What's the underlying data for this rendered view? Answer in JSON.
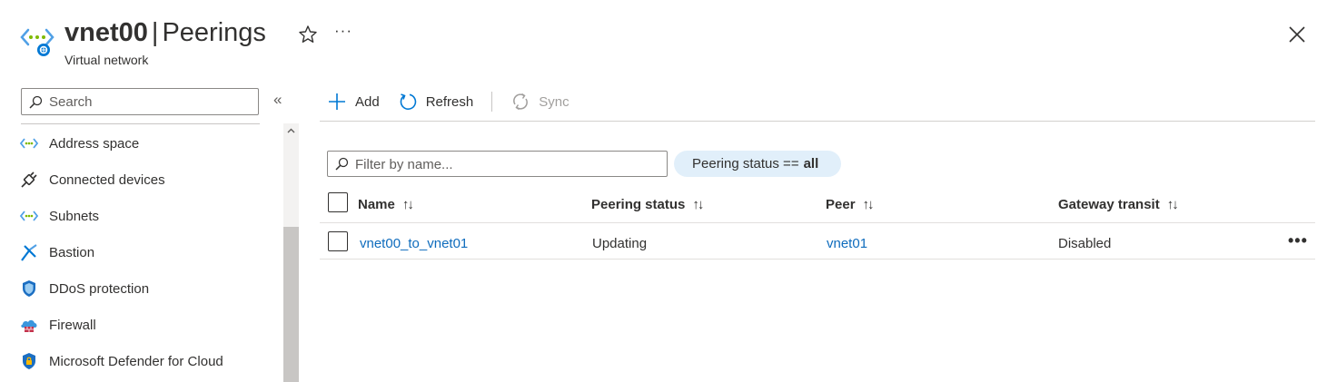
{
  "header": {
    "resource_name": "vnet00",
    "separator": "|",
    "page_name": "Peerings",
    "subtitle": "Virtual network",
    "more_label": "···",
    "icon": "virtual-network-icon"
  },
  "sidebar": {
    "search_placeholder": "Search",
    "collapse_label": "«",
    "items": [
      {
        "label": "Address space",
        "icon": "address-space-icon"
      },
      {
        "label": "Connected devices",
        "icon": "plug-icon"
      },
      {
        "label": "Subnets",
        "icon": "subnet-icon"
      },
      {
        "label": "Bastion",
        "icon": "bastion-icon"
      },
      {
        "label": "DDoS protection",
        "icon": "shield-icon"
      },
      {
        "label": "Firewall",
        "icon": "firewall-icon"
      },
      {
        "label": "Microsoft Defender for Cloud",
        "icon": "defender-icon"
      }
    ]
  },
  "toolbar": {
    "add_label": "Add",
    "refresh_label": "Refresh",
    "sync_label": "Sync"
  },
  "filter": {
    "placeholder": "Filter by name...",
    "pill_key": "Peering status ==",
    "pill_value": "all"
  },
  "table": {
    "columns": [
      {
        "label": "Name",
        "sort": "↑↓"
      },
      {
        "label": "Peering status",
        "sort": "↑↓"
      },
      {
        "label": "Peer",
        "sort": "↑↓"
      },
      {
        "label": "Gateway transit",
        "sort": "↑↓"
      }
    ],
    "rows": [
      {
        "name": "vnet00_to_vnet01",
        "status": "Updating",
        "peer": "vnet01",
        "gateway_transit": "Disabled",
        "more": "•••"
      }
    ]
  },
  "colors": {
    "link": "#0f6cbd",
    "accent": "#0078d4",
    "pill_bg": "#e1effa"
  }
}
